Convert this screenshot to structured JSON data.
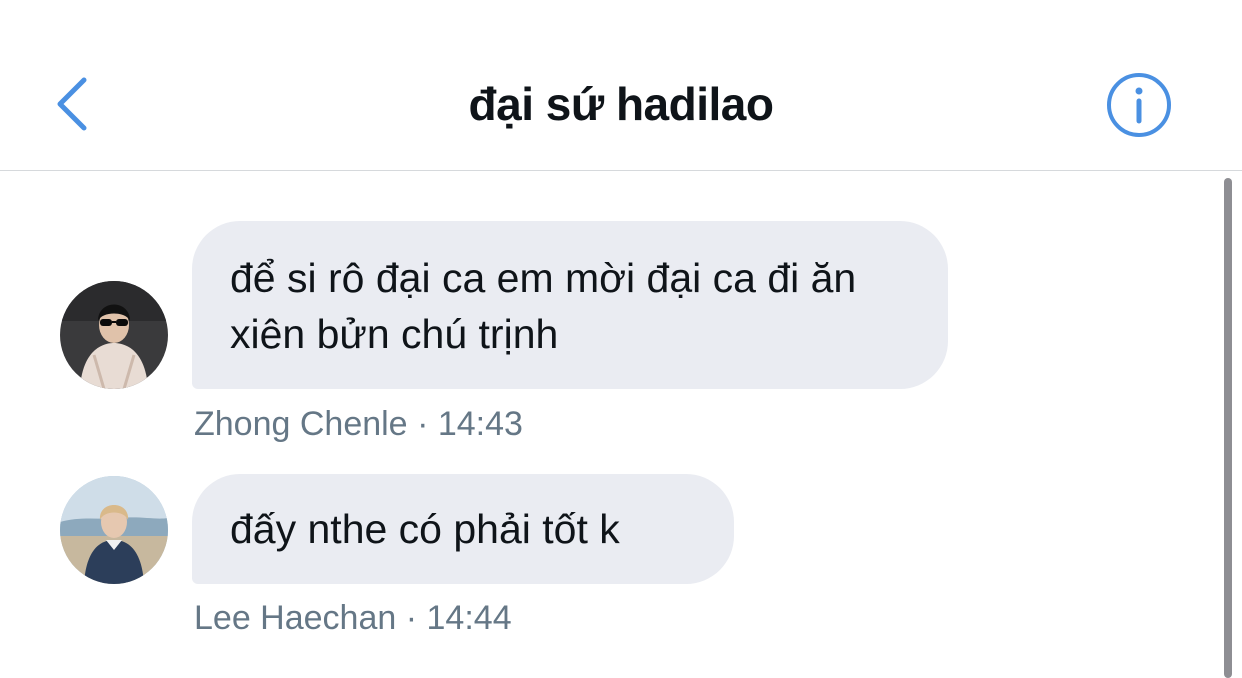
{
  "header": {
    "title": "đại sứ hadilao",
    "back_icon": "chevron-left-icon",
    "info_icon": "info-circle-icon",
    "accent_color": "#4a90e2"
  },
  "messages": [
    {
      "text": "để si rô đại ca em mời đại ca đi ăn xiên bửn chú trịnh",
      "sender": "Zhong Chenle",
      "separator": "·",
      "time": "14:43"
    },
    {
      "text": "đấy nthe có phải tốt k",
      "sender": "Lee Haechan",
      "separator": "·",
      "time": "14:44"
    }
  ]
}
